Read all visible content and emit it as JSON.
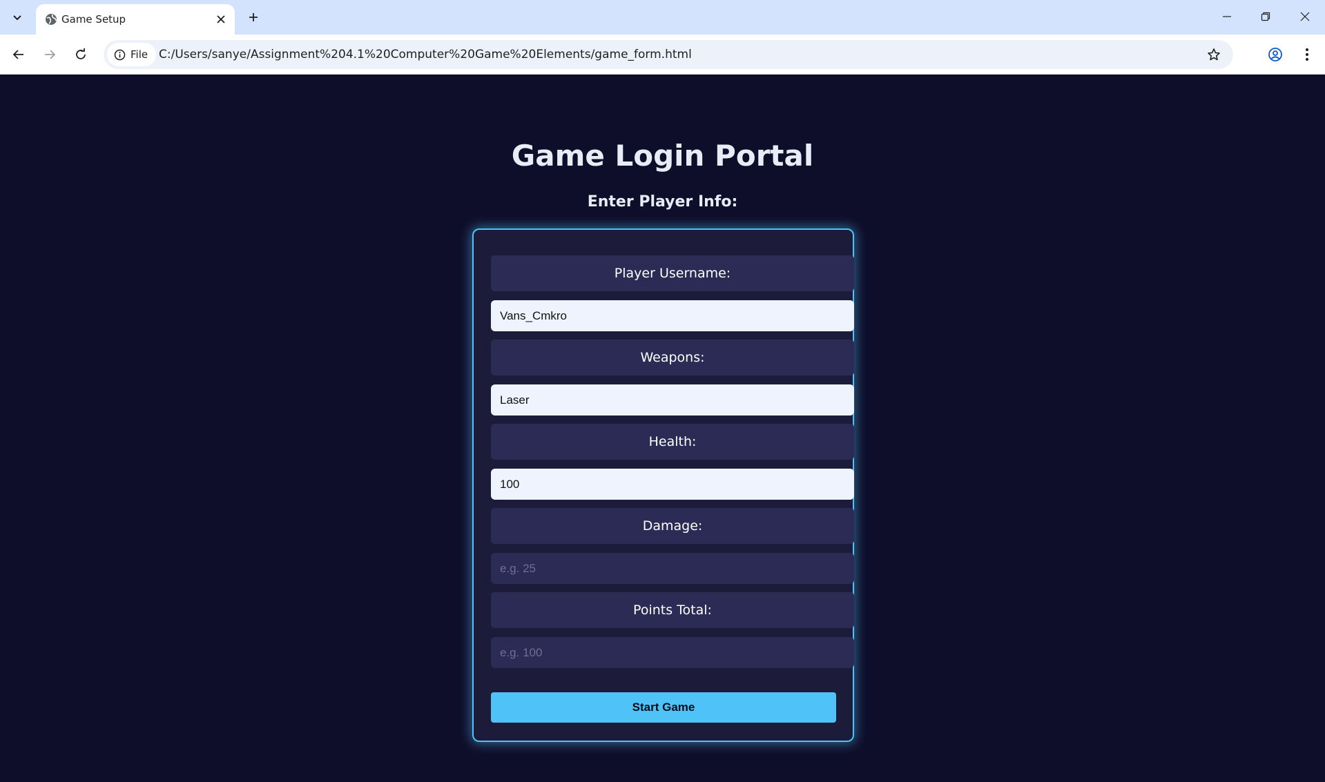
{
  "browser": {
    "tab_title": "Game Setup",
    "site_chip_label": "File",
    "url": "C:/Users/sanye/Assignment%204.1%20Computer%20Game%20Elements/game_form.html"
  },
  "page": {
    "title": "Game Login Portal",
    "subtitle": "Enter Player Info:"
  },
  "form": {
    "fields": [
      {
        "label": "Player Username:",
        "value": "Vans_Cmkro",
        "placeholder": ""
      },
      {
        "label": "Weapons:",
        "value": "Laser",
        "placeholder": ""
      },
      {
        "label": "Health:",
        "value": "100",
        "placeholder": ""
      },
      {
        "label": "Damage:",
        "value": "",
        "placeholder": "e.g. 25"
      },
      {
        "label": "Points Total:",
        "value": "",
        "placeholder": "e.g. 100"
      }
    ],
    "submit_label": "Start Game"
  },
  "colors": {
    "page_background": "#0f0e2a",
    "panel_border": "#4fc3f7",
    "button": "#4fc3f7",
    "label_background": "#2c2b55"
  }
}
